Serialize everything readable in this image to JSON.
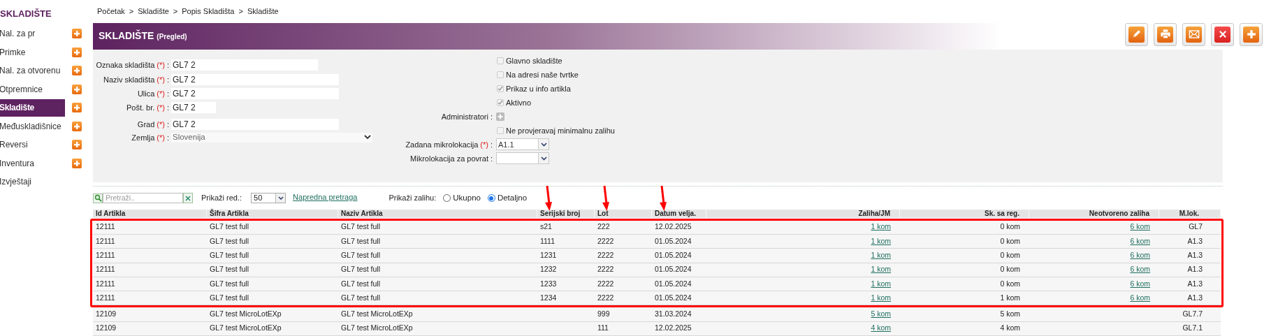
{
  "sidebar": {
    "title": "SKLADIŠTE",
    "items": [
      {
        "label": "Nal. za pr",
        "selected": false,
        "add_button": true
      },
      {
        "label": "Primke",
        "selected": false,
        "add_button": true
      },
      {
        "label": "Nal. za otvorenu",
        "selected": false,
        "add_button": true
      },
      {
        "label": "Otpremnice",
        "selected": false,
        "add_button": true
      },
      {
        "label": "Skladište",
        "selected": true,
        "add_button": true
      },
      {
        "label": "Međuskladišnice",
        "selected": false,
        "add_button": true
      },
      {
        "label": "Reversi",
        "selected": false,
        "add_button": true
      },
      {
        "label": "Inventura",
        "selected": false,
        "add_button": true
      },
      {
        "label": "Izvještaji",
        "selected": false,
        "add_button": false
      }
    ]
  },
  "breadcrumb": [
    "Početak",
    "Skladište",
    "Popis Skladišta",
    "Skladište"
  ],
  "breadcrumb_separator": ">",
  "header": {
    "title": "SKLADIŠTE",
    "subtitle": "(Pregled)"
  },
  "toolbar_buttons": [
    {
      "kind": "edit"
    },
    {
      "kind": "print"
    },
    {
      "kind": "email"
    },
    {
      "kind": "delete"
    },
    {
      "kind": "add"
    }
  ],
  "form": {
    "left_fields": [
      {
        "kind": "text",
        "label": "Oznaka skladišta",
        "marker": "(*)",
        "separator": ":",
        "value": "GL7 2"
      },
      {
        "kind": "text",
        "label": "Naziv skladišta",
        "marker": "(*)",
        "separator": ":",
        "value": "GL7 2"
      },
      {
        "kind": "text",
        "label": "Ulica",
        "marker": "(*)",
        "separator": ":",
        "value": "GL7 2"
      },
      {
        "kind": "text",
        "label": "Pošt. br.",
        "marker": "(*)",
        "separator": ":",
        "value": "GL7 2"
      },
      {
        "kind": "text",
        "label": "Grad",
        "marker": "(*)",
        "separator": ":",
        "value": "GL7 2"
      },
      {
        "kind": "select",
        "label": "Zemlja",
        "marker": "(*)",
        "separator": ":",
        "value": "Slovenija"
      }
    ],
    "right_fields": [
      {
        "kind": "checkbox",
        "label": "Glavno skladište",
        "checked": false
      },
      {
        "kind": "checkbox",
        "label": "Na adresi naše tvrtke",
        "checked": false
      },
      {
        "kind": "checkbox",
        "label": "Prikaz u info artikla",
        "checked": true
      },
      {
        "kind": "checkbox",
        "label": "Aktivno",
        "checked": true
      },
      {
        "kind": "add",
        "label": "Administratori",
        "separator": ":"
      },
      {
        "kind": "checkbox",
        "label": "Ne provjeravaj minimalnu zalihu",
        "checked": false
      },
      {
        "kind": "combo",
        "label": "Zadana mikrolokacija",
        "marker": "(*)",
        "separator": ":",
        "value": "A1.1"
      },
      {
        "kind": "combo",
        "label": "Mikrolokacija za povrat",
        "separator": ":"
      }
    ]
  },
  "list_toolbar": {
    "search_placeholder": "Pretraži..",
    "rows_label": "Prikaži red.:",
    "rows_value": "50",
    "advanced_link": "Napredna pretraga",
    "stock_label": "Prikaži zalihu:",
    "stock_options": [
      {
        "label": "Ukupno",
        "selected": false
      },
      {
        "label": "Detaljno",
        "selected": true
      }
    ]
  },
  "table": {
    "columns": [
      {
        "label": "Id Artikla",
        "kind": "text",
        "arrow": false
      },
      {
        "label": "Šifra Artikla",
        "kind": "text",
        "arrow": false
      },
      {
        "label": "Naziv Artikla",
        "kind": "text",
        "arrow": false
      },
      {
        "label": "Serijski broj",
        "kind": "text",
        "arrow": true
      },
      {
        "label": "Lot",
        "kind": "text",
        "arrow": true
      },
      {
        "label": "Datum velja.",
        "kind": "text",
        "arrow": true
      },
      {
        "label": "Zaliha/JM",
        "kind": "link",
        "arrow": false
      },
      {
        "label": "Sk. sa reg.",
        "kind": "text",
        "arrow": false
      },
      {
        "label": "Neotvoreno zaliha",
        "kind": "link",
        "arrow": false
      },
      {
        "label": "M.lok.",
        "kind": "text",
        "arrow": false
      }
    ],
    "rows": [
      {
        "highlighted": true,
        "cells": [
          "12111",
          "GL7 test full",
          "GL7 test full",
          "s21",
          "222",
          "12.02.2025",
          "1 kom",
          "0 kom",
          "6 kom",
          "GL7"
        ]
      },
      {
        "highlighted": true,
        "cells": [
          "12111",
          "GL7 test full",
          "GL7 test full",
          "1111",
          "2222",
          "01.05.2024",
          "1 kom",
          "0 kom",
          "6 kom",
          "A1.3"
        ]
      },
      {
        "highlighted": true,
        "cells": [
          "12111",
          "GL7 test full",
          "GL7 test full",
          "1231",
          "2222",
          "01.05.2024",
          "1 kom",
          "0 kom",
          "6 kom",
          "A1.3"
        ]
      },
      {
        "highlighted": true,
        "cells": [
          "12111",
          "GL7 test full",
          "GL7 test full",
          "1232",
          "2222",
          "01.05.2024",
          "1 kom",
          "0 kom",
          "6 kom",
          "A1.3"
        ]
      },
      {
        "highlighted": true,
        "cells": [
          "12111",
          "GL7 test full",
          "GL7 test full",
          "1233",
          "2222",
          "01.05.2024",
          "1 kom",
          "0 kom",
          "6 kom",
          "A1.3"
        ]
      },
      {
        "highlighted": true,
        "cells": [
          "12111",
          "GL7 test full",
          "GL7 test full",
          "1234",
          "2222",
          "01.05.2024",
          "1 kom",
          "1 kom",
          "6 kom",
          "A1.3"
        ]
      },
      {
        "highlighted": false,
        "cells": [
          "12109",
          "GL7 test MicroLotEXp",
          "GL7 test MicroLotEXp",
          null,
          "999",
          "31.03.2024",
          "5 kom",
          "5 kom",
          null,
          "GL7.7"
        ]
      },
      {
        "highlighted": false,
        "cells": [
          "12109",
          "GL7 test MicroLotEXp",
          "GL7 test MicroLotEXp",
          null,
          "111",
          "12.02.2025",
          "4 kom",
          "4 kom",
          null,
          "GL7.1"
        ]
      }
    ]
  }
}
